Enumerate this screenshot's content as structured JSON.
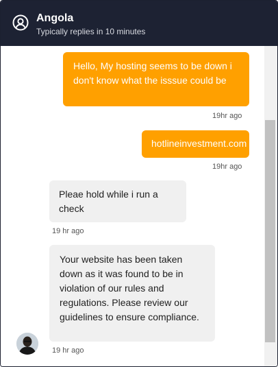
{
  "header": {
    "name": "Angola",
    "status": "Typically replies in 10 minutes"
  },
  "messages": [
    {
      "direction": "out",
      "text": "Hello, My hosting seems to be down i don't know what the isssue could be",
      "time": "19hr ago"
    },
    {
      "direction": "out",
      "text": "hotlineinvestment.com",
      "time": "19hr ago"
    },
    {
      "direction": "in",
      "text": "Pleae hold while i run a check",
      "time": "19 hr ago"
    },
    {
      "direction": "in",
      "text": "Your website has been taken down as it was found to be in violation of our rules and regulations. Please review our guidelines to ensure compliance.",
      "time": "19 hr ago"
    }
  ],
  "colors": {
    "header_bg": "#1d2233",
    "outgoing_bubble": "#ffa000",
    "incoming_bubble": "#f0f0f0"
  },
  "icons": {
    "header": "user-circle-icon"
  }
}
